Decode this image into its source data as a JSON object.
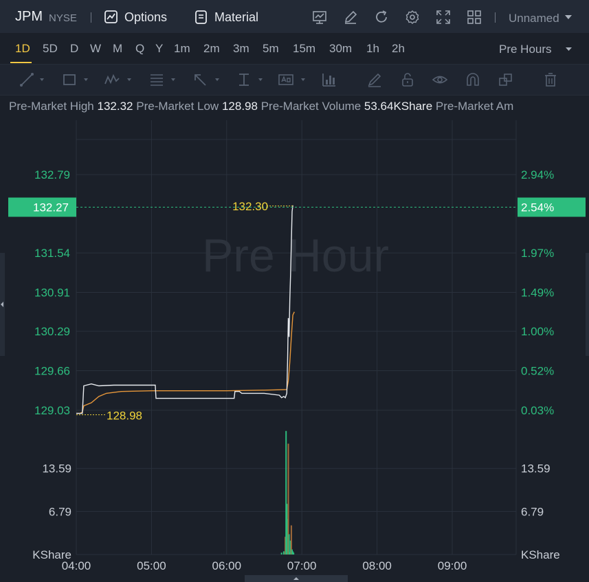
{
  "header": {
    "symbol": "JPM",
    "exchange": "NYSE",
    "options_label": "Options",
    "material_label": "Material",
    "layout_name": "Unnamed",
    "icons": [
      "chart-settings-icon",
      "edit-icon",
      "refresh-icon",
      "gear-icon",
      "fullscreen-icon",
      "grid-layout-icon"
    ]
  },
  "intervals": [
    "1D",
    "5D",
    "D",
    "W",
    "M",
    "Q",
    "Y",
    "1m",
    "2m",
    "3m",
    "5m",
    "15m",
    "30m",
    "1h",
    "2h"
  ],
  "active_interval": "1D",
  "session_label": "Pre Hours",
  "drawing_tools": [
    "trend-line-icon",
    "rectangle-icon",
    "pattern-icon",
    "fibonacci-icon",
    "arrow-icon",
    "measure-icon",
    "text-icon",
    "indicator-icon",
    "brush-icon",
    "lock-icon",
    "eye-icon",
    "magnet-icon",
    "layers-icon",
    "trash-icon"
  ],
  "stats": [
    {
      "label": "Pre-Market High",
      "value": "132.32"
    },
    {
      "label": "Pre-Market Low",
      "value": "128.98"
    },
    {
      "label": "Pre-Market Volume",
      "value": "53.64KShare"
    },
    {
      "label": "Pre-Market Am",
      "value": ""
    }
  ],
  "colors": {
    "up": "#2dbd7e",
    "price_line": "#e8ebef",
    "avg_line": "#e7973a",
    "highlight": "#f0d33a",
    "grid": "#2a313c"
  },
  "chart_data": {
    "type": "line",
    "watermark": "Pre Hour",
    "x_ticks": [
      "04:00",
      "05:00",
      "06:00",
      "07:00",
      "08:00",
      "09:00"
    ],
    "price_ticks": [
      "132.79",
      "131.54",
      "130.91",
      "130.29",
      "129.66",
      "129.03"
    ],
    "pct_ticks": [
      "2.94%",
      "1.97%",
      "1.49%",
      "1.00%",
      "0.52%",
      "0.03%"
    ],
    "current_price": "132.27",
    "current_pct": "2.54%",
    "high_label": "132.30",
    "low_label": "128.98",
    "ylim": [
      128.8,
      133.35
    ],
    "price_series": {
      "name": "Price",
      "x": [
        4.0,
        4.08,
        4.1,
        4.2,
        4.3,
        4.5,
        4.65,
        5.05,
        5.06,
        5.5,
        6.0,
        6.1,
        6.11,
        6.17,
        6.2,
        6.5,
        6.7,
        6.73,
        6.76,
        6.78,
        6.8,
        6.81,
        6.82,
        6.83,
        6.84,
        6.85,
        6.86,
        6.87,
        6.88
      ],
      "y": [
        128.98,
        128.98,
        129.42,
        129.45,
        129.42,
        129.43,
        129.43,
        129.43,
        129.22,
        129.22,
        129.22,
        129.22,
        129.33,
        129.33,
        129.3,
        129.3,
        129.27,
        129.23,
        129.25,
        129.23,
        129.3,
        129.8,
        130.5,
        130.2,
        130.8,
        131.2,
        131.7,
        132.2,
        132.3
      ]
    },
    "avg_series": {
      "name": "Average",
      "x": [
        4.0,
        4.05,
        4.08,
        4.1,
        4.2,
        4.3,
        4.4,
        4.6,
        5.0,
        5.5,
        6.0,
        6.5,
        6.8,
        6.82,
        6.84,
        6.86,
        6.88,
        6.9
      ],
      "y": [
        128.98,
        128.98,
        129.0,
        129.1,
        129.15,
        129.25,
        129.3,
        129.33,
        129.34,
        129.34,
        129.34,
        129.35,
        129.36,
        129.5,
        129.8,
        130.2,
        130.55,
        130.6
      ]
    },
    "volume": {
      "ticks": [
        "13.59",
        "6.79"
      ],
      "unit": "KShare",
      "ylim": [
        0,
        20.5
      ],
      "x": [
        6.73,
        6.76,
        6.78,
        6.79,
        6.8,
        6.81,
        6.82,
        6.83,
        6.84,
        6.85,
        6.86,
        6.87,
        6.88,
        6.89
      ],
      "values": [
        0.3,
        0.5,
        2.8,
        19.5,
        8.0,
        5.6,
        17.5,
        3.2,
        0.4,
        2.2,
        4.6,
        0.8,
        0.5,
        0.3
      ]
    }
  }
}
